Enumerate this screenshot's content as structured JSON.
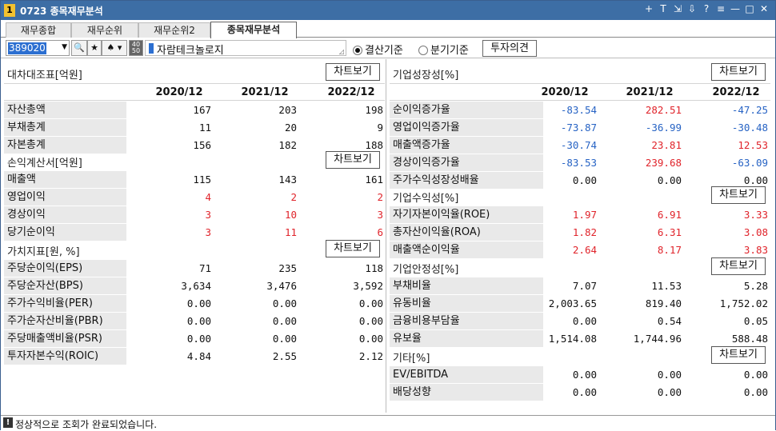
{
  "window": {
    "number": "1",
    "title": "0723 종목재무분석",
    "controls": [
      "+",
      "T",
      "⇲",
      "⇩",
      "?",
      "≡",
      "—",
      "□",
      "✕"
    ]
  },
  "tabs": [
    "재무종합",
    "재무순위",
    "재무순위2",
    "종목재무분석"
  ],
  "toolbar": {
    "code": "389020",
    "company": "자람테크놀로지",
    "radio_year": "결산기준",
    "radio_quarter": "분기기준",
    "invest_btn": "투자의견",
    "btn_4050": "40\n50"
  },
  "years": [
    "2020/12",
    "2021/12",
    "2022/12"
  ],
  "chart_btn": "차트보기",
  "left": [
    {
      "title": "대차대조표[억원]",
      "header": true,
      "rows": [
        {
          "label": "자산총액",
          "values": [
            "167",
            "203",
            "198"
          ],
          "colors": [
            "",
            "",
            ""
          ]
        },
        {
          "label": "부채총계",
          "values": [
            "11",
            "20",
            "9"
          ],
          "colors": [
            "",
            "",
            ""
          ]
        },
        {
          "label": "자본총계",
          "values": [
            "156",
            "182",
            "188"
          ],
          "colors": [
            "",
            "",
            ""
          ]
        }
      ]
    },
    {
      "title": "손익계산서[억원]",
      "header": false,
      "rows": [
        {
          "label": "매출액",
          "values": [
            "115",
            "143",
            "161"
          ],
          "colors": [
            "",
            "",
            ""
          ]
        },
        {
          "label": "영업이익",
          "values": [
            "4",
            "2",
            "2"
          ],
          "colors": [
            "red",
            "red",
            "red"
          ]
        },
        {
          "label": "경상이익",
          "values": [
            "3",
            "10",
            "3"
          ],
          "colors": [
            "red",
            "red",
            "red"
          ]
        },
        {
          "label": "당기순이익",
          "values": [
            "3",
            "11",
            "6"
          ],
          "colors": [
            "red",
            "red",
            "red"
          ]
        }
      ]
    },
    {
      "title": "가치지표[원, %]",
      "header": false,
      "rows": [
        {
          "label": "주당순이익(EPS)",
          "values": [
            "71",
            "235",
            "118"
          ],
          "colors": [
            "",
            "",
            ""
          ]
        },
        {
          "label": "주당순자산(BPS)",
          "values": [
            "3,634",
            "3,476",
            "3,592"
          ],
          "colors": [
            "",
            "",
            ""
          ]
        },
        {
          "label": "주가수익비율(PER)",
          "values": [
            "0.00",
            "0.00",
            "0.00"
          ],
          "colors": [
            "",
            "",
            ""
          ]
        },
        {
          "label": "주가순자산비율(PBR)",
          "values": [
            "0.00",
            "0.00",
            "0.00"
          ],
          "colors": [
            "",
            "",
            ""
          ]
        },
        {
          "label": "주당매출액비율(PSR)",
          "values": [
            "0.00",
            "0.00",
            "0.00"
          ],
          "colors": [
            "",
            "",
            ""
          ]
        },
        {
          "label": "투자자본수익(ROIC)",
          "values": [
            "4.84",
            "2.55",
            "2.12"
          ],
          "colors": [
            "",
            "",
            ""
          ]
        }
      ]
    }
  ],
  "right": [
    {
      "title": "기업성장성[%]",
      "header": true,
      "rows": [
        {
          "label": "순이익증가율",
          "values": [
            "-83.54",
            "282.51",
            "-47.25"
          ],
          "colors": [
            "blue",
            "red",
            "blue"
          ]
        },
        {
          "label": "영업이익증가율",
          "values": [
            "-73.87",
            "-36.99",
            "-30.48"
          ],
          "colors": [
            "blue",
            "blue",
            "blue"
          ]
        },
        {
          "label": "매출액증가율",
          "values": [
            "-30.74",
            "23.81",
            "12.53"
          ],
          "colors": [
            "blue",
            "red",
            "red"
          ]
        },
        {
          "label": "경상이익증가율",
          "values": [
            "-83.53",
            "239.68",
            "-63.09"
          ],
          "colors": [
            "blue",
            "red",
            "blue"
          ]
        },
        {
          "label": "주가수익성장성배율",
          "values": [
            "0.00",
            "0.00",
            "0.00"
          ],
          "colors": [
            "",
            "",
            ""
          ]
        }
      ]
    },
    {
      "title": "기업수익성[%]",
      "header": false,
      "rows": [
        {
          "label": "자기자본이익율(ROE)",
          "values": [
            "1.97",
            "6.91",
            "3.33"
          ],
          "colors": [
            "red",
            "red",
            "red"
          ]
        },
        {
          "label": "총자산이익율(ROA)",
          "values": [
            "1.82",
            "6.31",
            "3.08"
          ],
          "colors": [
            "red",
            "red",
            "red"
          ]
        },
        {
          "label": "매출액순이익율",
          "values": [
            "2.64",
            "8.17",
            "3.83"
          ],
          "colors": [
            "red",
            "red",
            "red"
          ]
        }
      ]
    },
    {
      "title": "기업안정성[%]",
      "header": false,
      "rows": [
        {
          "label": "부채비율",
          "values": [
            "7.07",
            "11.53",
            "5.28"
          ],
          "colors": [
            "",
            "",
            ""
          ]
        },
        {
          "label": "유동비율",
          "values": [
            "2,003.65",
            "819.40",
            "1,752.02"
          ],
          "colors": [
            "",
            "",
            ""
          ]
        },
        {
          "label": "금융비용부담율",
          "values": [
            "0.00",
            "0.54",
            "0.05"
          ],
          "colors": [
            "",
            "",
            ""
          ]
        },
        {
          "label": "유보율",
          "values": [
            "1,514.08",
            "1,744.96",
            "588.48"
          ],
          "colors": [
            "",
            "",
            ""
          ]
        }
      ]
    },
    {
      "title": "기타[%]",
      "header": false,
      "rows": [
        {
          "label": "EV/EBITDA",
          "values": [
            "0.00",
            "0.00",
            "0.00"
          ],
          "colors": [
            "",
            "",
            ""
          ]
        },
        {
          "label": "배당성향",
          "values": [
            "0.00",
            "0.00",
            "0.00"
          ],
          "colors": [
            "",
            "",
            ""
          ]
        }
      ]
    }
  ],
  "status": {
    "icon": "!",
    "message": "정상적으로 조회가 완료되었습니다."
  }
}
